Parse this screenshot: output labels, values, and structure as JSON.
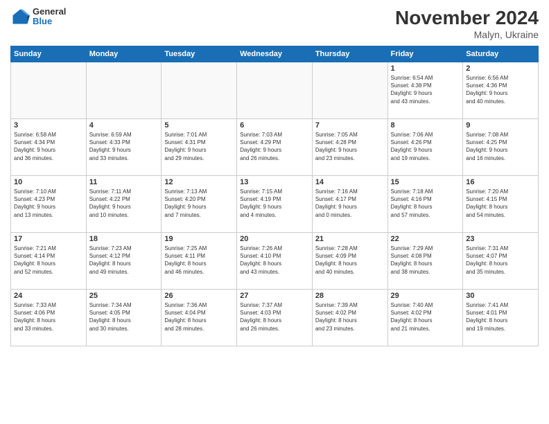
{
  "header": {
    "logo": {
      "general": "General",
      "blue": "Blue"
    },
    "title": "November 2024",
    "subtitle": "Malyn, Ukraine"
  },
  "columns": [
    "Sunday",
    "Monday",
    "Tuesday",
    "Wednesday",
    "Thursday",
    "Friday",
    "Saturday"
  ],
  "weeks": [
    [
      {
        "day": "",
        "info": ""
      },
      {
        "day": "",
        "info": ""
      },
      {
        "day": "",
        "info": ""
      },
      {
        "day": "",
        "info": ""
      },
      {
        "day": "",
        "info": ""
      },
      {
        "day": "1",
        "info": "Sunrise: 6:54 AM\nSunset: 4:38 PM\nDaylight: 9 hours\nand 43 minutes."
      },
      {
        "day": "2",
        "info": "Sunrise: 6:56 AM\nSunset: 4:36 PM\nDaylight: 9 hours\nand 40 minutes."
      }
    ],
    [
      {
        "day": "3",
        "info": "Sunrise: 6:58 AM\nSunset: 4:34 PM\nDaylight: 9 hours\nand 36 minutes."
      },
      {
        "day": "4",
        "info": "Sunrise: 6:59 AM\nSunset: 4:33 PM\nDaylight: 9 hours\nand 33 minutes."
      },
      {
        "day": "5",
        "info": "Sunrise: 7:01 AM\nSunset: 4:31 PM\nDaylight: 9 hours\nand 29 minutes."
      },
      {
        "day": "6",
        "info": "Sunrise: 7:03 AM\nSunset: 4:29 PM\nDaylight: 9 hours\nand 26 minutes."
      },
      {
        "day": "7",
        "info": "Sunrise: 7:05 AM\nSunset: 4:28 PM\nDaylight: 9 hours\nand 23 minutes."
      },
      {
        "day": "8",
        "info": "Sunrise: 7:06 AM\nSunset: 4:26 PM\nDaylight: 9 hours\nand 19 minutes."
      },
      {
        "day": "9",
        "info": "Sunrise: 7:08 AM\nSunset: 4:25 PM\nDaylight: 9 hours\nand 16 minutes."
      }
    ],
    [
      {
        "day": "10",
        "info": "Sunrise: 7:10 AM\nSunset: 4:23 PM\nDaylight: 9 hours\nand 13 minutes."
      },
      {
        "day": "11",
        "info": "Sunrise: 7:11 AM\nSunset: 4:22 PM\nDaylight: 9 hours\nand 10 minutes."
      },
      {
        "day": "12",
        "info": "Sunrise: 7:13 AM\nSunset: 4:20 PM\nDaylight: 9 hours\nand 7 minutes."
      },
      {
        "day": "13",
        "info": "Sunrise: 7:15 AM\nSunset: 4:19 PM\nDaylight: 9 hours\nand 4 minutes."
      },
      {
        "day": "14",
        "info": "Sunrise: 7:16 AM\nSunset: 4:17 PM\nDaylight: 9 hours\nand 0 minutes."
      },
      {
        "day": "15",
        "info": "Sunrise: 7:18 AM\nSunset: 4:16 PM\nDaylight: 8 hours\nand 57 minutes."
      },
      {
        "day": "16",
        "info": "Sunrise: 7:20 AM\nSunset: 4:15 PM\nDaylight: 8 hours\nand 54 minutes."
      }
    ],
    [
      {
        "day": "17",
        "info": "Sunrise: 7:21 AM\nSunset: 4:14 PM\nDaylight: 8 hours\nand 52 minutes."
      },
      {
        "day": "18",
        "info": "Sunrise: 7:23 AM\nSunset: 4:12 PM\nDaylight: 8 hours\nand 49 minutes."
      },
      {
        "day": "19",
        "info": "Sunrise: 7:25 AM\nSunset: 4:11 PM\nDaylight: 8 hours\nand 46 minutes."
      },
      {
        "day": "20",
        "info": "Sunrise: 7:26 AM\nSunset: 4:10 PM\nDaylight: 8 hours\nand 43 minutes."
      },
      {
        "day": "21",
        "info": "Sunrise: 7:28 AM\nSunset: 4:09 PM\nDaylight: 8 hours\nand 40 minutes."
      },
      {
        "day": "22",
        "info": "Sunrise: 7:29 AM\nSunset: 4:08 PM\nDaylight: 8 hours\nand 38 minutes."
      },
      {
        "day": "23",
        "info": "Sunrise: 7:31 AM\nSunset: 4:07 PM\nDaylight: 8 hours\nand 35 minutes."
      }
    ],
    [
      {
        "day": "24",
        "info": "Sunrise: 7:33 AM\nSunset: 4:06 PM\nDaylight: 8 hours\nand 33 minutes."
      },
      {
        "day": "25",
        "info": "Sunrise: 7:34 AM\nSunset: 4:05 PM\nDaylight: 8 hours\nand 30 minutes."
      },
      {
        "day": "26",
        "info": "Sunrise: 7:36 AM\nSunset: 4:04 PM\nDaylight: 8 hours\nand 28 minutes."
      },
      {
        "day": "27",
        "info": "Sunrise: 7:37 AM\nSunset: 4:03 PM\nDaylight: 8 hours\nand 26 minutes."
      },
      {
        "day": "28",
        "info": "Sunrise: 7:39 AM\nSunset: 4:02 PM\nDaylight: 8 hours\nand 23 minutes."
      },
      {
        "day": "29",
        "info": "Sunrise: 7:40 AM\nSunset: 4:02 PM\nDaylight: 8 hours\nand 21 minutes."
      },
      {
        "day": "30",
        "info": "Sunrise: 7:41 AM\nSunset: 4:01 PM\nDaylight: 8 hours\nand 19 minutes."
      }
    ]
  ]
}
